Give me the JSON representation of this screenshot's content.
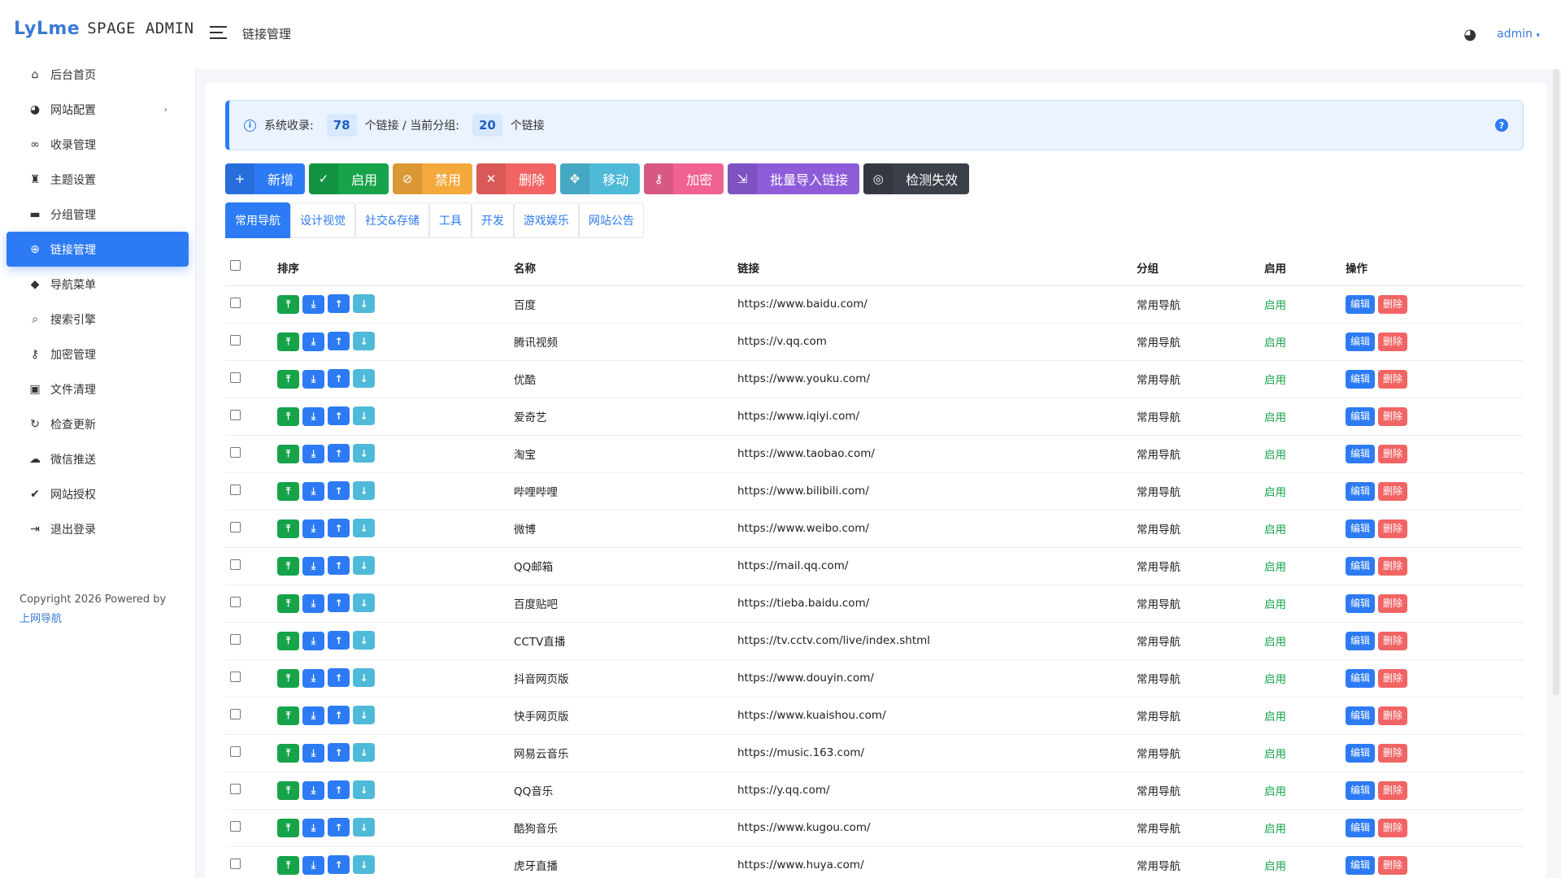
{
  "app": {
    "brand": "LyLme",
    "subtitle": "SPAGE ADMIN"
  },
  "header": {
    "title": "链接管理",
    "user": "admin"
  },
  "sidebar": {
    "items": [
      {
        "label": "后台首页",
        "icon": "home-icon",
        "glyph": "⌂"
      },
      {
        "label": "网站配置",
        "icon": "palette-icon",
        "glyph": "◕",
        "has_sub": true
      },
      {
        "label": "收录管理",
        "icon": "link-icon",
        "glyph": "∞"
      },
      {
        "label": "主题设置",
        "icon": "theme-icon",
        "glyph": "♜"
      },
      {
        "label": "分组管理",
        "icon": "folder-icon",
        "glyph": "▬"
      },
      {
        "label": "链接管理",
        "icon": "globe-icon",
        "glyph": "⊕",
        "active": true
      },
      {
        "label": "导航菜单",
        "icon": "cube-icon",
        "glyph": "◆"
      },
      {
        "label": "搜索引擎",
        "icon": "search-icon",
        "glyph": "⌕"
      },
      {
        "label": "加密管理",
        "icon": "key-icon",
        "glyph": "⚷"
      },
      {
        "label": "文件清理",
        "icon": "image-icon",
        "glyph": "▣"
      },
      {
        "label": "检查更新",
        "icon": "refresh-icon",
        "glyph": "↻"
      },
      {
        "label": "微信推送",
        "icon": "wechat-icon",
        "glyph": "☁"
      },
      {
        "label": "网站授权",
        "icon": "check-circle-icon",
        "glyph": "✔"
      },
      {
        "label": "退出登录",
        "icon": "logout-icon",
        "glyph": "⇥"
      }
    ],
    "copyright": "Copyright 2026 Powered by",
    "copyright_link": "上网导航"
  },
  "info": {
    "prefix": "系统收录:",
    "total": "78",
    "mid": "个链接 / 当前分组:",
    "group_count": "20",
    "suffix": "个链接",
    "help": "?"
  },
  "toolbar": [
    {
      "label": "新增",
      "glyph": "+",
      "color": "#2d7bf4",
      "name": "add-button"
    },
    {
      "label": "启用",
      "glyph": "✓",
      "color": "#16a34a",
      "name": "enable-button"
    },
    {
      "label": "禁用",
      "glyph": "⊘",
      "color": "#f4a93c",
      "name": "disable-button"
    },
    {
      "label": "删除",
      "glyph": "✕",
      "color": "#f26464",
      "name": "delete-button"
    },
    {
      "label": "移动",
      "glyph": "✥",
      "color": "#4fbad8",
      "name": "move-button"
    },
    {
      "label": "加密",
      "glyph": "⚷",
      "color": "#f06292",
      "name": "encrypt-button"
    },
    {
      "label": "批量导入链接",
      "glyph": "⇲",
      "color": "#8e5cd9",
      "name": "batch-import-button"
    },
    {
      "label": "检测失效",
      "glyph": "◎",
      "color": "#3a4049",
      "name": "check-invalid-button"
    }
  ],
  "tabs": [
    "常用导航",
    "设计视觉",
    "社交&存储",
    "工具",
    "开发",
    "游戏娱乐",
    "网站公告"
  ],
  "table": {
    "headers": {
      "sort": "排序",
      "name": "名称",
      "link": "链接",
      "group": "分组",
      "enabled": "启用",
      "actions": "操作"
    },
    "edit_label": "编辑",
    "delete_label": "删除",
    "rows": [
      {
        "name": "百度",
        "link": "https://www.baidu.com/",
        "group": "常用导航",
        "enabled": "启用"
      },
      {
        "name": "腾讯视频",
        "link": "https://v.qq.com",
        "group": "常用导航",
        "enabled": "启用"
      },
      {
        "name": "优酷",
        "link": "https://www.youku.com/",
        "group": "常用导航",
        "enabled": "启用"
      },
      {
        "name": "爱奇艺",
        "link": "https://www.iqiyi.com/",
        "group": "常用导航",
        "enabled": "启用"
      },
      {
        "name": "淘宝",
        "link": "https://www.taobao.com/",
        "group": "常用导航",
        "enabled": "启用"
      },
      {
        "name": "哔哩哔哩",
        "link": "https://www.bilibili.com/",
        "group": "常用导航",
        "enabled": "启用"
      },
      {
        "name": "微博",
        "link": "https://www.weibo.com/",
        "group": "常用导航",
        "enabled": "启用"
      },
      {
        "name": "QQ邮箱",
        "link": "https://mail.qq.com/",
        "group": "常用导航",
        "enabled": "启用"
      },
      {
        "name": "百度贴吧",
        "link": "https://tieba.baidu.com/",
        "group": "常用导航",
        "enabled": "启用"
      },
      {
        "name": "CCTV直播",
        "link": "https://tv.cctv.com/live/index.shtml",
        "group": "常用导航",
        "enabled": "启用"
      },
      {
        "name": "抖音网页版",
        "link": "https://www.douyin.com/",
        "group": "常用导航",
        "enabled": "启用"
      },
      {
        "name": "快手网页版",
        "link": "https://www.kuaishou.com/",
        "group": "常用导航",
        "enabled": "启用"
      },
      {
        "name": "网易云音乐",
        "link": "https://music.163.com/",
        "group": "常用导航",
        "enabled": "启用"
      },
      {
        "name": "QQ音乐",
        "link": "https://y.qq.com/",
        "group": "常用导航",
        "enabled": "启用"
      },
      {
        "name": "酷狗音乐",
        "link": "https://www.kugou.com/",
        "group": "常用导航",
        "enabled": "启用"
      },
      {
        "name": "虎牙直播",
        "link": "https://www.huya.com/",
        "group": "常用导航",
        "enabled": "启用"
      }
    ]
  },
  "sort_buttons": [
    {
      "name": "move-top-button",
      "glyph": "⤒",
      "color": "#16a34a"
    },
    {
      "name": "move-bottom-button",
      "glyph": "⤓",
      "color": "#2d7bf4"
    },
    {
      "name": "move-up-button",
      "glyph": "↑",
      "color": "#2d7bf4"
    },
    {
      "name": "move-down-button",
      "glyph": "↓",
      "color": "#4fbad8"
    }
  ],
  "colors": {
    "primary": "#2d7bf4",
    "success": "#16a34a",
    "danger": "#f26464"
  }
}
